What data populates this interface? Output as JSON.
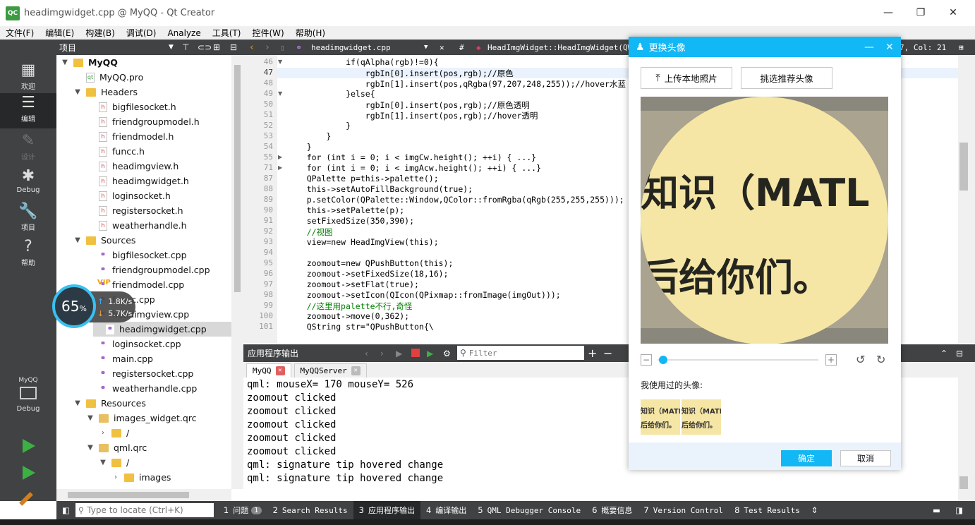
{
  "window": {
    "title": "headimgwidget.cpp @ MyQQ - Qt Creator",
    "app_icon": "QC",
    "minimize": "—",
    "restore": "❐",
    "close": "✕"
  },
  "menu": [
    "文件(F)",
    "编辑(E)",
    "构建(B)",
    "调试(D)",
    "Analyze",
    "工具(T)",
    "控件(W)",
    "帮助(H)"
  ],
  "modes": [
    {
      "icon": "grid-icon",
      "glyph": "▦",
      "label": "欢迎"
    },
    {
      "icon": "edit-icon",
      "glyph": "☰",
      "label": "编辑"
    },
    {
      "icon": "pencil-icon",
      "glyph": "✎",
      "label": "设计"
    },
    {
      "icon": "bug-icon",
      "glyph": "✱",
      "label": "Debug"
    },
    {
      "icon": "wrench-icon",
      "glyph": "🔧",
      "label": "项目"
    },
    {
      "icon": "help-icon",
      "glyph": "?",
      "label": "帮助"
    }
  ],
  "kit": {
    "project": "MyQQ",
    "label": "Debug"
  },
  "project_panel": {
    "title": "项目"
  },
  "tree": [
    {
      "label": "MyQQ",
      "type": "root",
      "toggle": "▼",
      "bold": true
    },
    {
      "label": "MyQQ.pro",
      "type": "pro"
    },
    {
      "label": "Headers",
      "type": "folder",
      "toggle": "▼"
    },
    {
      "label": "bigfilesocket.h",
      "type": "h"
    },
    {
      "label": "friendgroupmodel.h",
      "type": "h"
    },
    {
      "label": "friendmodel.h",
      "type": "h"
    },
    {
      "label": "funcc.h",
      "type": "h"
    },
    {
      "label": "headimgview.h",
      "type": "h"
    },
    {
      "label": "headimgwidget.h",
      "type": "h"
    },
    {
      "label": "loginsocket.h",
      "type": "h"
    },
    {
      "label": "registersocket.h",
      "type": "h"
    },
    {
      "label": "weatherhandle.h",
      "type": "h"
    },
    {
      "label": "Sources",
      "type": "folder",
      "toggle": "▼"
    },
    {
      "label": "bigfilesocket.cpp",
      "type": "cpp"
    },
    {
      "label": "friendgroupmodel.cpp",
      "type": "cpp"
    },
    {
      "label": "friendmodel.cpp",
      "type": "cpp"
    },
    {
      "label": "funcc.cpp",
      "type": "cpp"
    },
    {
      "label": "headimgview.cpp",
      "type": "cpp"
    },
    {
      "label": "headimgwidget.cpp",
      "type": "cpp",
      "selected": true
    },
    {
      "label": "loginsocket.cpp",
      "type": "cpp"
    },
    {
      "label": "main.cpp",
      "type": "cpp"
    },
    {
      "label": "registersocket.cpp",
      "type": "cpp"
    },
    {
      "label": "weatherhandle.cpp",
      "type": "cpp"
    },
    {
      "label": "Resources",
      "type": "folder",
      "toggle": "▼"
    },
    {
      "label": "images_widget.qrc",
      "type": "qrc",
      "toggle": "▼"
    },
    {
      "label": "/",
      "type": "folder",
      "toggle": "›"
    },
    {
      "label": "qml.qrc",
      "type": "qrc",
      "toggle": "▼"
    },
    {
      "label": "/",
      "type": "folder",
      "toggle": "▼"
    },
    {
      "label": "images",
      "type": "folder",
      "toggle": "›"
    }
  ],
  "editor": {
    "file": "headimgwidget.cpp",
    "function": "HeadImgWidget::HeadImgWidget(QWid",
    "cursor": "7, Col: 21",
    "lines": [
      {
        "n": "46",
        "fold": "▼",
        "code": "            if(qAlpha(rgb)!=0){"
      },
      {
        "n": "47",
        "fold": "",
        "code": "                rgbIn[0].insert(pos,rgb);//原色",
        "hl": true
      },
      {
        "n": "48",
        "fold": "",
        "code": "                rgbIn[1].insert(pos,qRgba(97,207,248,255));//hover水蓝"
      },
      {
        "n": "49",
        "fold": "▼",
        "code": "            }else{"
      },
      {
        "n": "50",
        "fold": "",
        "code": "                rgbIn[0].insert(pos,rgb);//原色透明"
      },
      {
        "n": "51",
        "fold": "",
        "code": "                rgbIn[1].insert(pos,rgb);//hover透明"
      },
      {
        "n": "52",
        "fold": "",
        "code": "            }"
      },
      {
        "n": "53",
        "fold": "",
        "code": "        }"
      },
      {
        "n": "54",
        "fold": "",
        "code": "    }"
      },
      {
        "n": "55",
        "fold": "▶",
        "code": "    for (int i = 0; i < imgCw.height(); ++i) { ...}"
      },
      {
        "n": "71",
        "fold": "▶",
        "code": "    for (int i = 0; i < imgAcw.height(); ++i) { ...}"
      },
      {
        "n": "87",
        "fold": "",
        "code": "    QPalette p=this->palette();"
      },
      {
        "n": "88",
        "fold": "",
        "code": "    this->setAutoFillBackground(true);"
      },
      {
        "n": "89",
        "fold": "",
        "code": "    p.setColor(QPalette::Window,QColor::fromRgba(qRgb(255,255,255)));"
      },
      {
        "n": "90",
        "fold": "",
        "code": "    this->setPalette(p);"
      },
      {
        "n": "91",
        "fold": "",
        "code": "    setFixedSize(350,390);"
      },
      {
        "n": "92",
        "fold": "",
        "code": "    //视图"
      },
      {
        "n": "93",
        "fold": "",
        "code": "    view=new HeadImgView(this);"
      },
      {
        "n": "94",
        "fold": "",
        "code": ""
      },
      {
        "n": "95",
        "fold": "",
        "code": "    zoomout=new QPushButton(this);"
      },
      {
        "n": "96",
        "fold": "",
        "code": "    zoomout->setFixedSize(18,16);"
      },
      {
        "n": "97",
        "fold": "",
        "code": "    zoomout->setFlat(true);"
      },
      {
        "n": "98",
        "fold": "",
        "code": "    zoomout->setIcon(QIcon(QPixmap::fromImage(imgOut)));"
      },
      {
        "n": "99",
        "fold": "",
        "code": "    //这里用palette不行,奇怪"
      },
      {
        "n": "100",
        "fold": "",
        "code": "    zoomout->move(0,362);"
      },
      {
        "n": "101",
        "fold": "",
        "code": "    QString str=\"QPushButton{\\"
      }
    ]
  },
  "output_panel": {
    "title": "应用程序输出",
    "filter_placeholder": "Filter",
    "tabs": [
      "MyQQ",
      "MyQQServer"
    ],
    "lines": [
      "qml: mouseX= 170 mouseY= 526",
      "zoomout clicked",
      "zoomout clicked",
      "zoomout clicked",
      "zoomout clicked",
      "zoomout clicked",
      "qml: signature tip hovered change",
      "qml: signature tip hovered change"
    ]
  },
  "statusbar": {
    "locate_placeholder": "Type to locate (Ctrl+K)",
    "tabs": [
      {
        "num": "1",
        "label": "问题",
        "badge": "1"
      },
      {
        "num": "2",
        "label": "Search Results"
      },
      {
        "num": "3",
        "label": "应用程序输出",
        "active": true
      },
      {
        "num": "4",
        "label": "编译输出"
      },
      {
        "num": "5",
        "label": "QML Debugger Console"
      },
      {
        "num": "6",
        "label": "概要信息"
      },
      {
        "num": "7",
        "label": "Version Control"
      },
      {
        "num": "8",
        "label": "Test Results"
      }
    ]
  },
  "speed_widget": {
    "percent": "65",
    "unit": "%",
    "up": "1.8K/s",
    "down": "5.7K/s",
    "badge": "VIP"
  },
  "dialog": {
    "title": "更换头像",
    "upload_button": "上传本地照片",
    "recommend_button": "挑选推荐头像",
    "image_text_line1": "知识（MATL",
    "image_text_line2": "后给你们。",
    "recent_label": "我使用过的头像:",
    "thumb_line1": "知识（MATL",
    "thumb_line2": "后给你们。",
    "zoom_level": 0,
    "ok_button": "确定",
    "cancel_button": "取消",
    "accent": "#12b7f5"
  },
  "colors": {
    "dark_panel": "#404244",
    "mode_active": "#262829",
    "run_green": "#3cb043"
  }
}
